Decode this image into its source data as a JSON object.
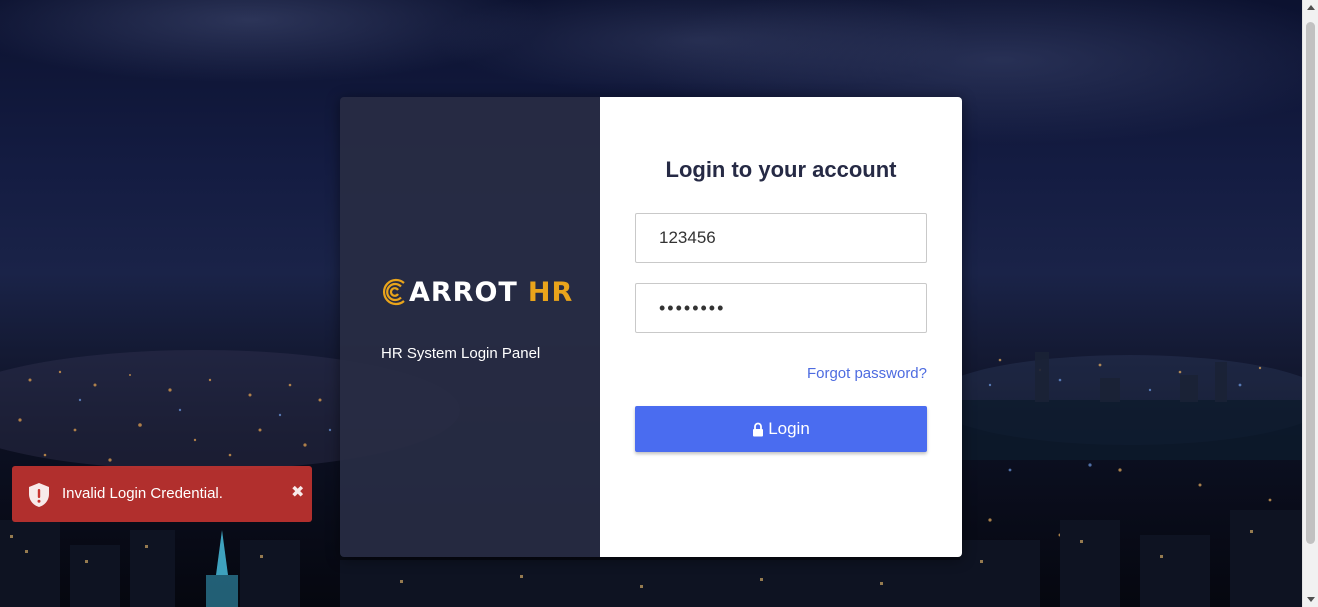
{
  "brand": {
    "logo_text": "ARROT",
    "logo_accent": "HR",
    "subtitle": "HR System Login Panel",
    "colors": {
      "accent": "#e9a41b",
      "panel": "#282c44"
    }
  },
  "login_form": {
    "title": "Login to your account",
    "username_value": "123456",
    "password_value": "••••••••",
    "forgot_password_label": "Forgot password?",
    "login_button_label": "Login",
    "login_button_color": "#4a6cf0"
  },
  "toast": {
    "message": "Invalid Login Credential.",
    "close_symbol": "✖",
    "color": "#c83430"
  }
}
